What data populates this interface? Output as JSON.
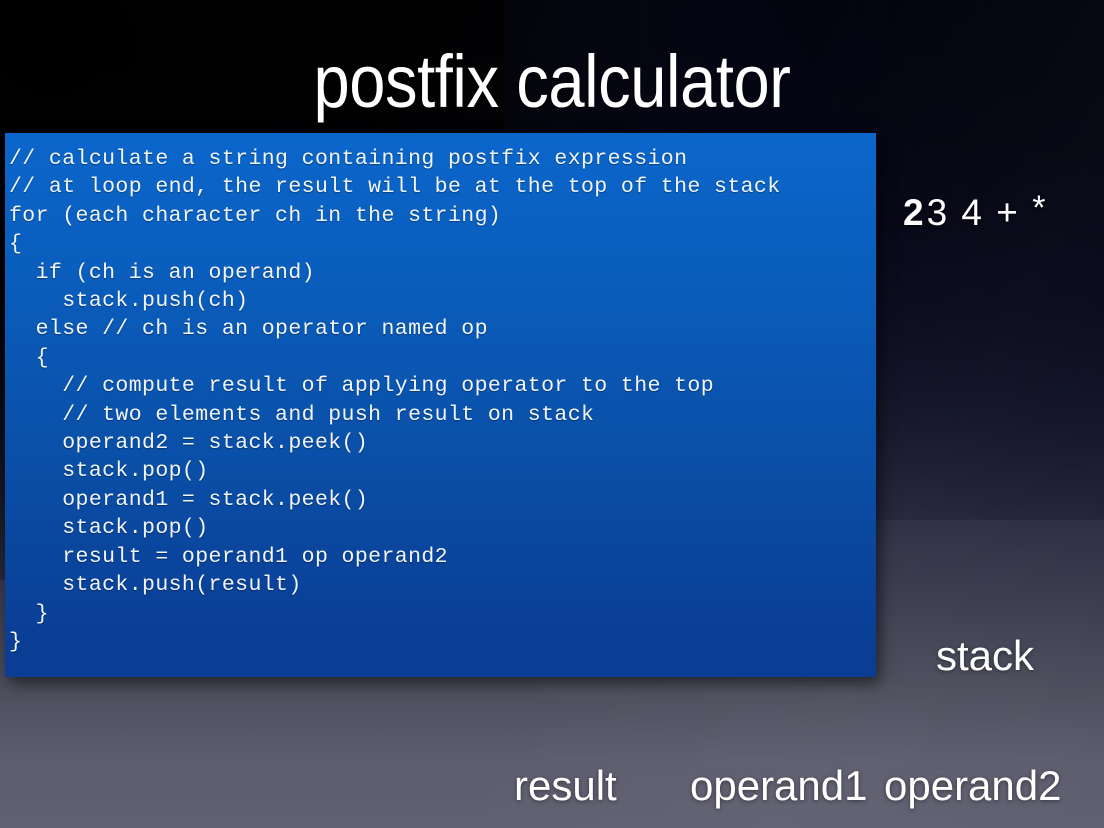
{
  "slide": {
    "title": "postfix calculator",
    "background": {
      "top_color": "#050508",
      "bottom_color": "#60607 1",
      "accent_panel_color": "#0b66cb"
    }
  },
  "code_panel": {
    "language": "pseudocode",
    "background_top": "#0b66cb",
    "background_bottom": "#0a3d93",
    "text_color": "#f2f6fb",
    "lines": [
      "// calculate a string containing postfix expression",
      "// at loop end, the result will be at the top of the stack",
      "for (each character ch in the string)",
      "{",
      "  if (ch is an operand)",
      "    stack.push(ch)",
      "  else // ch is an operator named op",
      "  {",
      "    // compute result of applying operator to the top",
      "    // two elements and push result on stack",
      "    operand2 = stack.peek()",
      "    stack.pop()",
      "    operand1 = stack.peek()",
      "    stack.pop()",
      "    result = operand1 op operand2",
      "    stack.push(result)",
      "  }",
      "}"
    ],
    "text": "// calculate a string containing postfix expression\n// at loop end, the result will be at the top of the stack\nfor (each character ch in the string)\n{\n  if (ch is an operand)\n    stack.push(ch)\n  else // ch is an operator named op\n  {\n    // compute result of applying operator to the top\n    // two elements and push result on stack\n    operand2 = stack.peek()\n    stack.pop()\n    operand1 = stack.peek()\n    stack.pop()\n    result = operand1 op operand2\n    stack.push(result)\n  }\n}"
  },
  "expression": {
    "full": "2 3 4 + *",
    "current_token": "2",
    "remaining_tokens": "3 4 + ",
    "last_token": "*"
  },
  "labels": {
    "stack": "stack",
    "result": "result",
    "operand1": "operand1",
    "operand2": "operand2"
  }
}
